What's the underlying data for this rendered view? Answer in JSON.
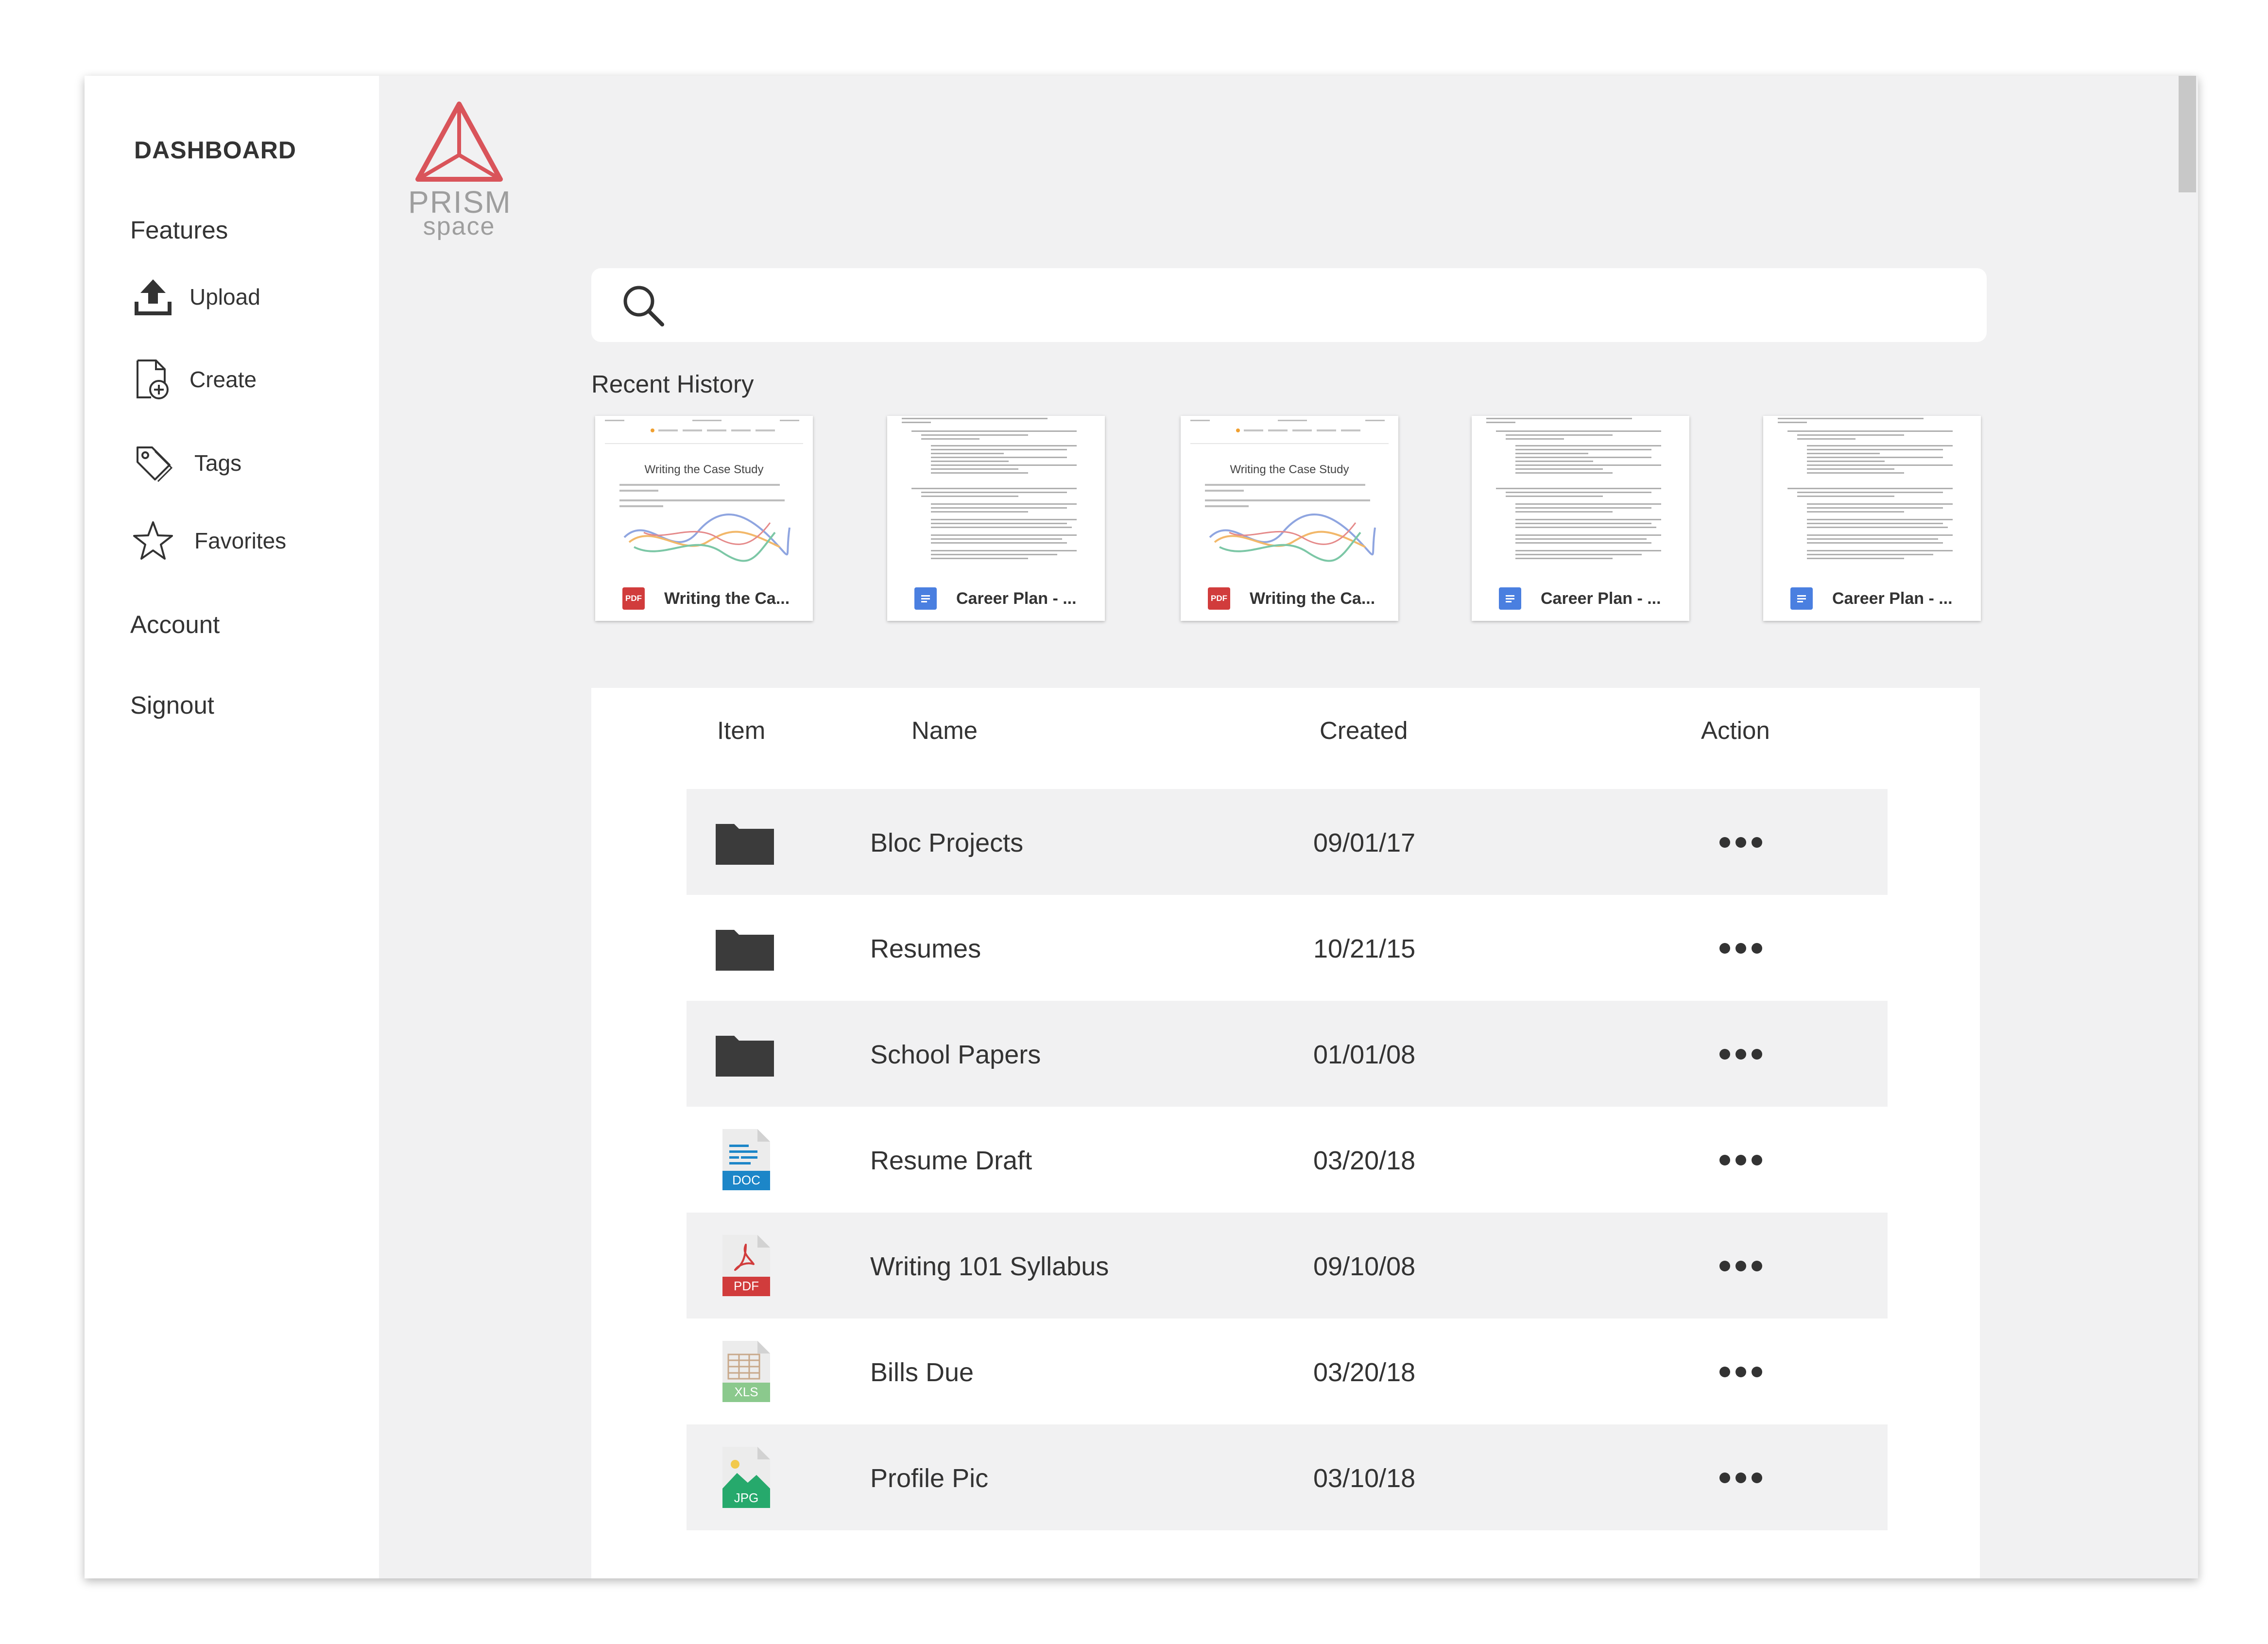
{
  "sidebar": {
    "title": "DASHBOARD",
    "features_heading": "Features",
    "items": [
      {
        "label": "Upload",
        "icon": "upload-icon"
      },
      {
        "label": "Create",
        "icon": "create-file-icon"
      },
      {
        "label": "Tags",
        "icon": "tag-icon"
      },
      {
        "label": "Favorites",
        "icon": "star-icon"
      }
    ],
    "account": "Account",
    "signout": "Signout"
  },
  "logo": {
    "line1": "PRISM",
    "line2": "space",
    "color": "#d9545a"
  },
  "search": {
    "placeholder": ""
  },
  "recent": {
    "title": "Recent History",
    "items": [
      {
        "name": "Writing the Ca...",
        "type": "PDF",
        "preview_title": "Writing the Case Study"
      },
      {
        "name": "Career Plan - ...",
        "type": "DOC"
      },
      {
        "name": "Writing the Ca...",
        "type": "PDF",
        "preview_title": "Writing the Case Study"
      },
      {
        "name": "Career Plan - ...",
        "type": "DOC"
      },
      {
        "name": "Career Plan - ...",
        "type": "DOC"
      }
    ]
  },
  "table": {
    "headers": {
      "item": "Item",
      "name": "Name",
      "created": "Created",
      "action": "Action"
    },
    "rows": [
      {
        "icon": "folder-icon",
        "name": "Bloc Projects",
        "created": "09/01/17"
      },
      {
        "icon": "folder-icon",
        "name": "Resumes",
        "created": "10/21/15"
      },
      {
        "icon": "folder-icon",
        "name": "School Papers",
        "created": "01/01/08"
      },
      {
        "icon": "doc-file-icon",
        "badge": "DOC",
        "name": "Resume Draft",
        "created": "03/20/18"
      },
      {
        "icon": "pdf-file-icon",
        "badge": "PDF",
        "name": "Writing 101 Syllabus",
        "created": "09/10/08"
      },
      {
        "icon": "xls-file-icon",
        "badge": "XLS",
        "name": "Bills Due",
        "created": "03/20/18"
      },
      {
        "icon": "jpg-file-icon",
        "badge": "JPG",
        "name": "Profile Pic",
        "created": "03/10/18"
      }
    ]
  },
  "colors": {
    "pdf": "#d13c3c",
    "doc": "#1c86c8",
    "xls": "#6fbf73",
    "jpg": "#26a96c",
    "gdoc": "#4a7fe0"
  }
}
